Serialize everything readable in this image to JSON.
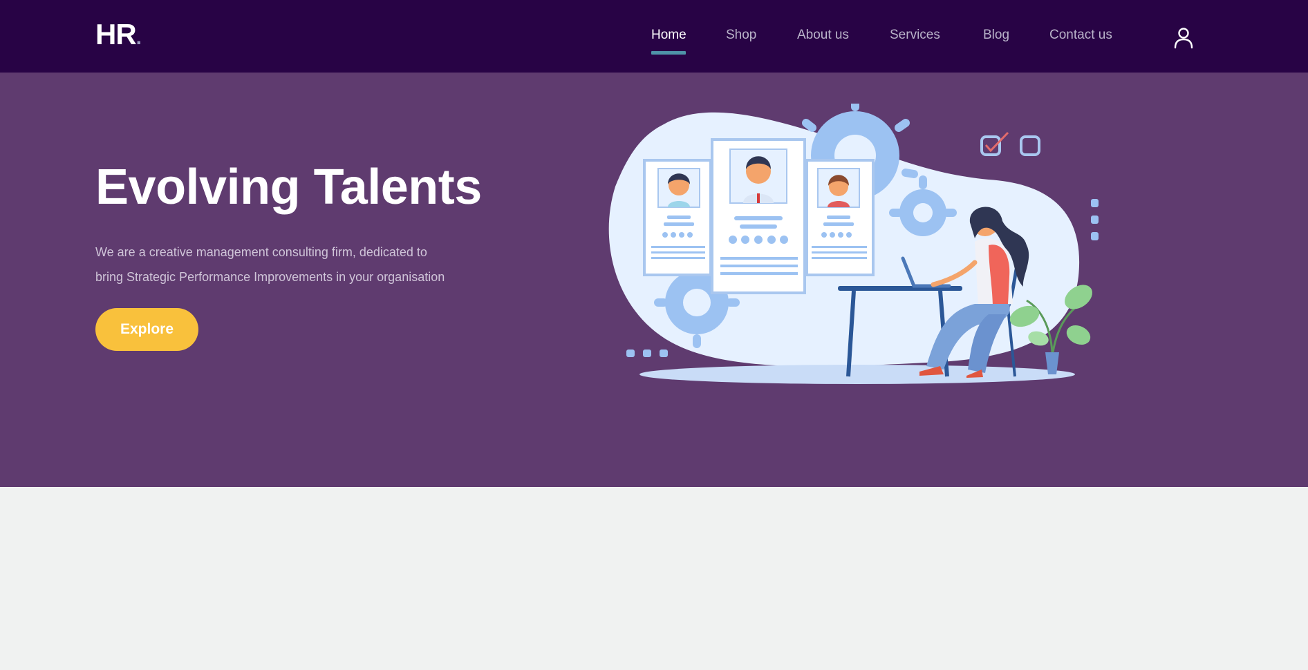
{
  "header": {
    "logo": "HR",
    "logo_dot": ".",
    "nav": [
      {
        "label": "Home",
        "active": true
      },
      {
        "label": "Shop",
        "active": false
      },
      {
        "label": "About us",
        "active": false
      },
      {
        "label": "Services",
        "active": false
      },
      {
        "label": "Blog",
        "active": false
      },
      {
        "label": "Contact us",
        "active": false
      }
    ],
    "user_icon": "user-icon"
  },
  "hero": {
    "title": "Evolving Talents",
    "description_line1": "We are a creative management consulting firm, dedicated to",
    "description_line2": "bring Strategic Performance Improvements in your organisation",
    "button_label": "Explore"
  },
  "colors": {
    "header_bg": "#280345",
    "hero_bg": "#5f3b6f",
    "accent": "#f9c13c",
    "nav_active_underline": "#4f93a8",
    "page_bg": "#f0f2f1"
  }
}
